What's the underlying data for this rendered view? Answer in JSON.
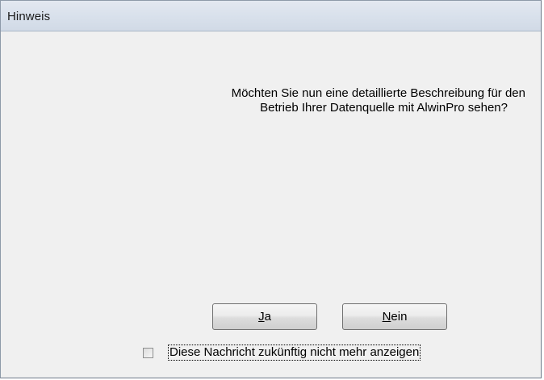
{
  "dialog": {
    "title": "Hinweis",
    "message_line1": "Möchten Sie nun eine detaillierte Beschreibung für den",
    "message_line2": "Betrieb Ihrer Datenquelle mit AlwinPro sehen?",
    "yes_button": {
      "mnemonic": "J",
      "rest": "a"
    },
    "no_button": {
      "mnemonic": "N",
      "rest": "ein"
    },
    "checkbox_label": "Diese Nachricht zukünftig nicht mehr anzeigen",
    "checkbox_checked": false
  }
}
